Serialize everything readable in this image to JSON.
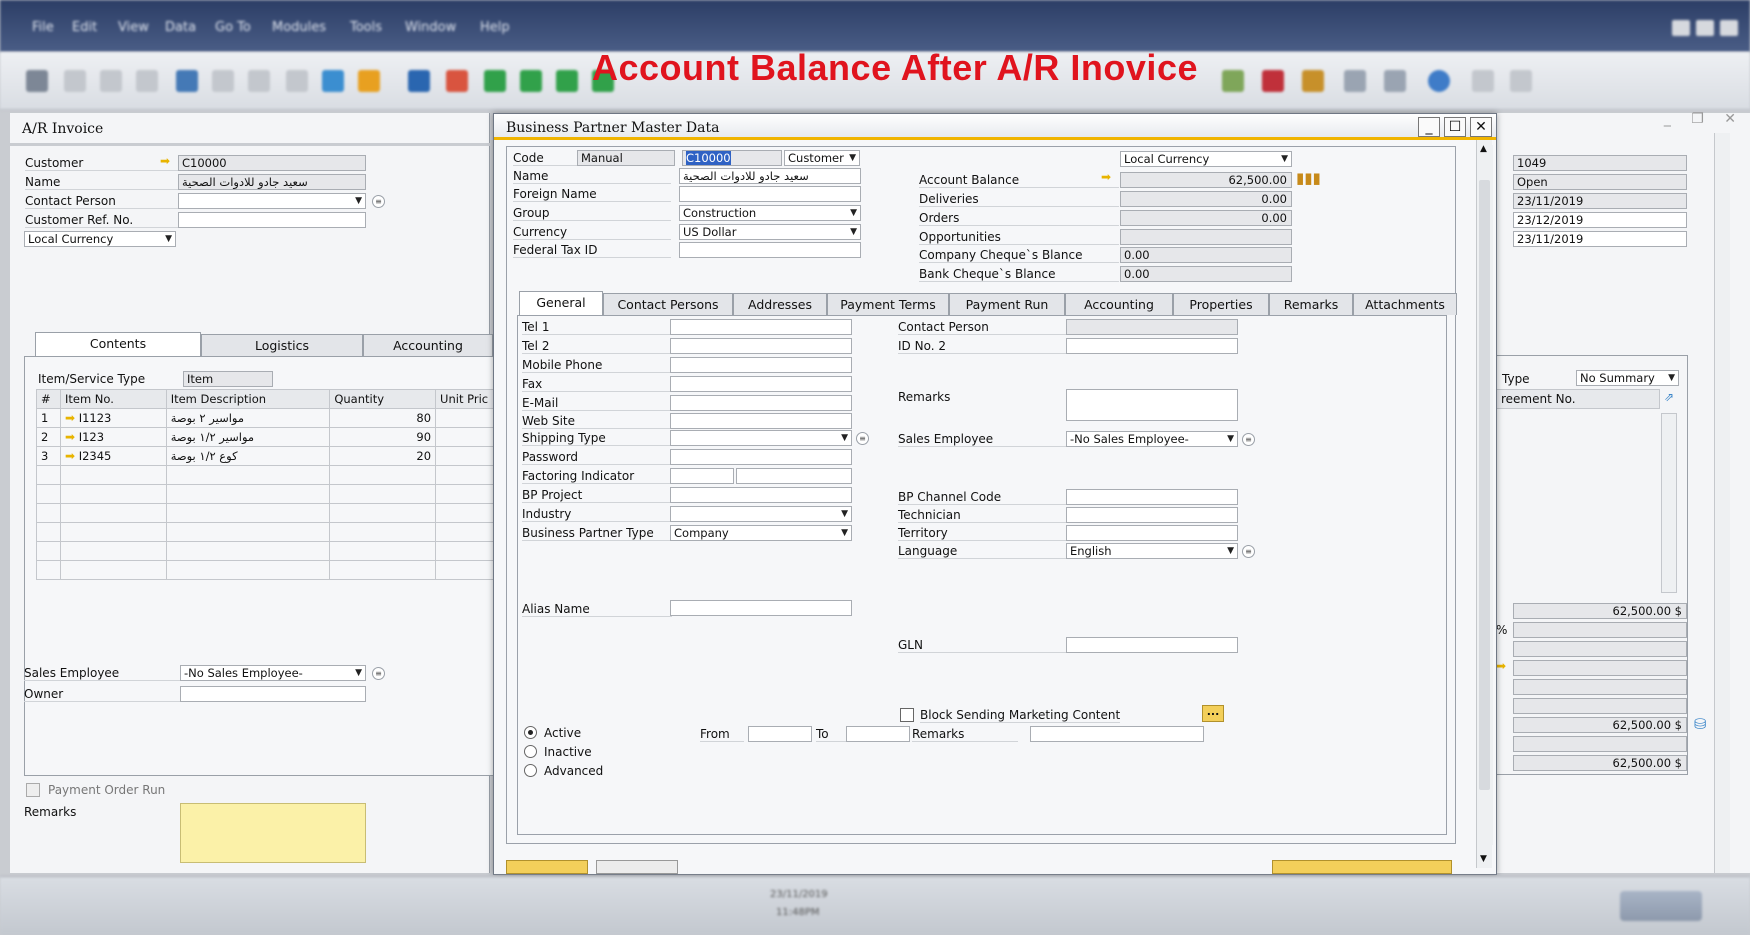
{
  "headline": "Account Balance After A/R Inovice",
  "menu": [
    "File",
    "Edit",
    "View",
    "Data",
    "Go To",
    "Modules",
    "Tools",
    "Window",
    "Help"
  ],
  "invoice": {
    "title": "A/R Invoice",
    "customer_label": "Customer",
    "customer_value": "C10000",
    "name_label": "Name",
    "name_value": "سعيد جادو للادوات الصحية",
    "contact_label": "Contact Person",
    "ref_label": "Customer Ref. No.",
    "currency_select": "Local Currency",
    "tabs": [
      "Contents",
      "Logistics",
      "Accounting"
    ],
    "item_type_label": "Item/Service Type",
    "item_type_value": "Item",
    "columns": [
      "#",
      "Item No.",
      "Item Description",
      "Quantity",
      "Unit Pric"
    ],
    "rows": [
      {
        "n": "1",
        "item": "I1123",
        "desc": "مواسير ٢ بوصة",
        "qty": "80"
      },
      {
        "n": "2",
        "item": "I123",
        "desc": "مواسير ١/٢ بوصة",
        "qty": "90"
      },
      {
        "n": "3",
        "item": "I2345",
        "desc": "كوع ١/٢ بوصة",
        "qty": "20"
      }
    ],
    "sales_emp_label": "Sales Employee",
    "sales_emp_value": "-No Sales Employee-",
    "owner_label": "Owner",
    "payment_order_label": "Payment Order Run",
    "remarks_label": "Remarks"
  },
  "back_right": {
    "values": [
      "1049",
      "Open",
      "23/11/2019",
      "23/12/2019",
      "23/11/2019"
    ],
    "type_label": "Type",
    "type_value": "No Summary",
    "agreement_label": "reement No.",
    "totals": [
      "62,500.00 $",
      "62,500.00 $",
      "62,500.00 $"
    ],
    "pct": "%"
  },
  "bp": {
    "title": "Business Partner Master Data",
    "code_label": "Code",
    "code_series": "Manual",
    "code_value": "C10000",
    "code_type": "Customer",
    "name_label": "Name",
    "name_value": "سعيد جادو للادوات الصحية",
    "foreign_label": "Foreign Name",
    "group_label": "Group",
    "group_value": "Construction",
    "currency_label": "Currency",
    "currency_value": "US Dollar",
    "tax_label": "Federal Tax ID",
    "currency_view": "Local Currency",
    "balance_label": "Account Balance",
    "balance_value": "62,500.00",
    "deliveries_label": "Deliveries",
    "deliveries_value": "0.00",
    "orders_label": "Orders",
    "orders_value": "0.00",
    "opps_label": "Opportunities",
    "company_cheque_label": "Company Cheque`s Blance",
    "company_cheque_value": "0.00",
    "bank_cheque_label": "Bank Cheque`s Blance",
    "bank_cheque_value": "0.00",
    "tabs": [
      "General",
      "Contact Persons",
      "Addresses",
      "Payment Terms",
      "Payment Run",
      "Accounting",
      "Properties",
      "Remarks",
      "Attachments"
    ],
    "left_fields": [
      "Tel 1",
      "Tel 2",
      "Mobile Phone",
      "Fax",
      "E-Mail",
      "Web Site",
      "Shipping Type",
      "Password",
      "Factoring Indicator",
      "BP Project",
      "Industry",
      "Business Partner Type"
    ],
    "bp_type_value": "Company",
    "alias_label": "Alias Name",
    "right_fields": {
      "contact": "Contact Person",
      "id2": "ID No. 2",
      "remarks": "Remarks",
      "sales_emp": "Sales Employee",
      "sales_emp_value": "-No Sales Employee-",
      "channel": "BP Channel Code",
      "technician": "Technician",
      "territory": "Territory",
      "language": "Language",
      "language_value": "English",
      "gln": "GLN"
    },
    "block_marketing": "Block Sending Marketing Content",
    "more_btn": "...",
    "status": [
      "Active",
      "Inactive",
      "Advanced"
    ],
    "from_label": "From",
    "to_label": "To",
    "remarks2_label": "Remarks"
  },
  "status_bar": {
    "date": "23/11/2019",
    "time": "11:48PM"
  }
}
